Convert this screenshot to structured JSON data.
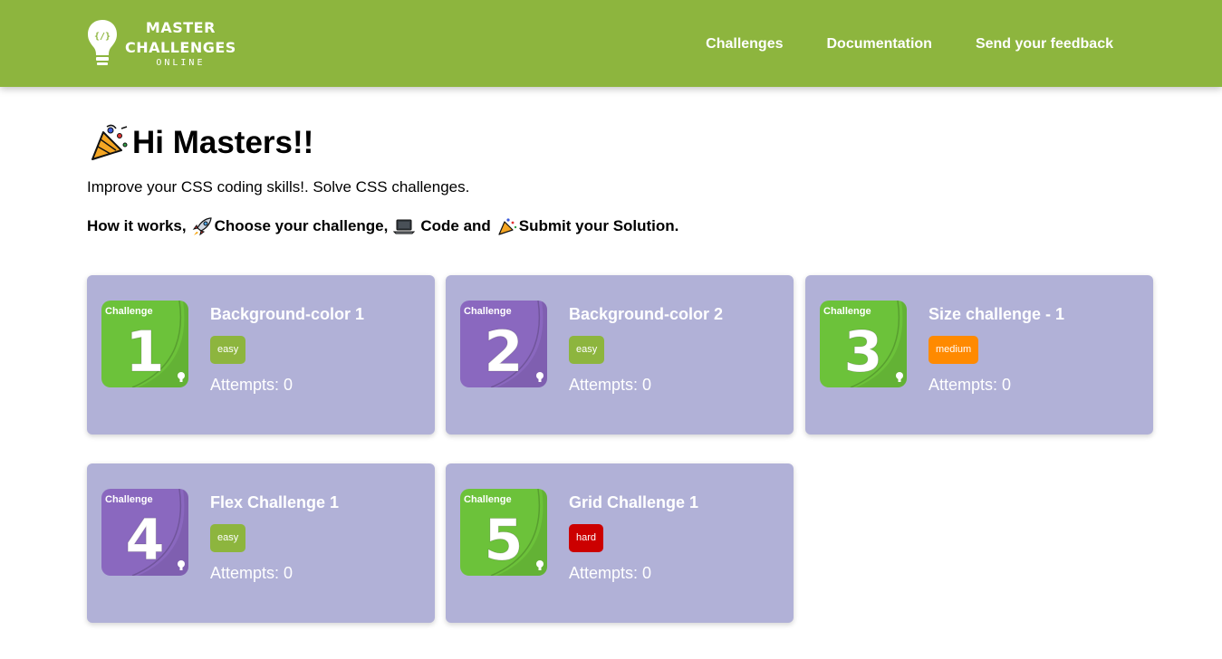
{
  "brand": {
    "line1": "MASTER",
    "line2": "CHALLENGES",
    "line3": "ONLINE",
    "color": "#8db53e"
  },
  "nav": [
    {
      "label": "Challenges"
    },
    {
      "label": "Documentation"
    },
    {
      "label": "Send your feedback"
    }
  ],
  "hero": {
    "title": "Hi Masters!!",
    "intro": "Improve your CSS coding skills!. Solve CSS challenges.",
    "how_prefix": "How it works,",
    "step1": "Choose your challenge,",
    "step2": "Code and",
    "step3": "Submit your Solution."
  },
  "card_color": "#b1b1d7",
  "difficulty_colors": {
    "easy": "#8db53e",
    "medium": "#ff8a00",
    "hard": "#cc0000"
  },
  "challenges": [
    {
      "number": "1",
      "thumb_label": "Challenge",
      "title": "Background-color 1",
      "difficulty": "easy",
      "attempts_label": "Attempts:",
      "attempts": "0",
      "thumb_color": "#6cc23a"
    },
    {
      "number": "2",
      "thumb_label": "Challenge",
      "title": "Background-color 2",
      "difficulty": "easy",
      "attempts_label": "Attempts:",
      "attempts": "0",
      "thumb_color": "#8a68bf"
    },
    {
      "number": "3",
      "thumb_label": "Challenge",
      "title": "Size challenge - 1",
      "difficulty": "medium",
      "attempts_label": "Attempts:",
      "attempts": "0",
      "thumb_color": "#6cc23a"
    },
    {
      "number": "4",
      "thumb_label": "Challenge",
      "title": "Flex Challenge 1",
      "difficulty": "easy",
      "attempts_label": "Attempts:",
      "attempts": "0",
      "thumb_color": "#8a68bf"
    },
    {
      "number": "5",
      "thumb_label": "Challenge",
      "title": "Grid Challenge 1",
      "difficulty": "hard",
      "attempts_label": "Attempts:",
      "attempts": "0",
      "thumb_color": "#6cc23a"
    }
  ]
}
